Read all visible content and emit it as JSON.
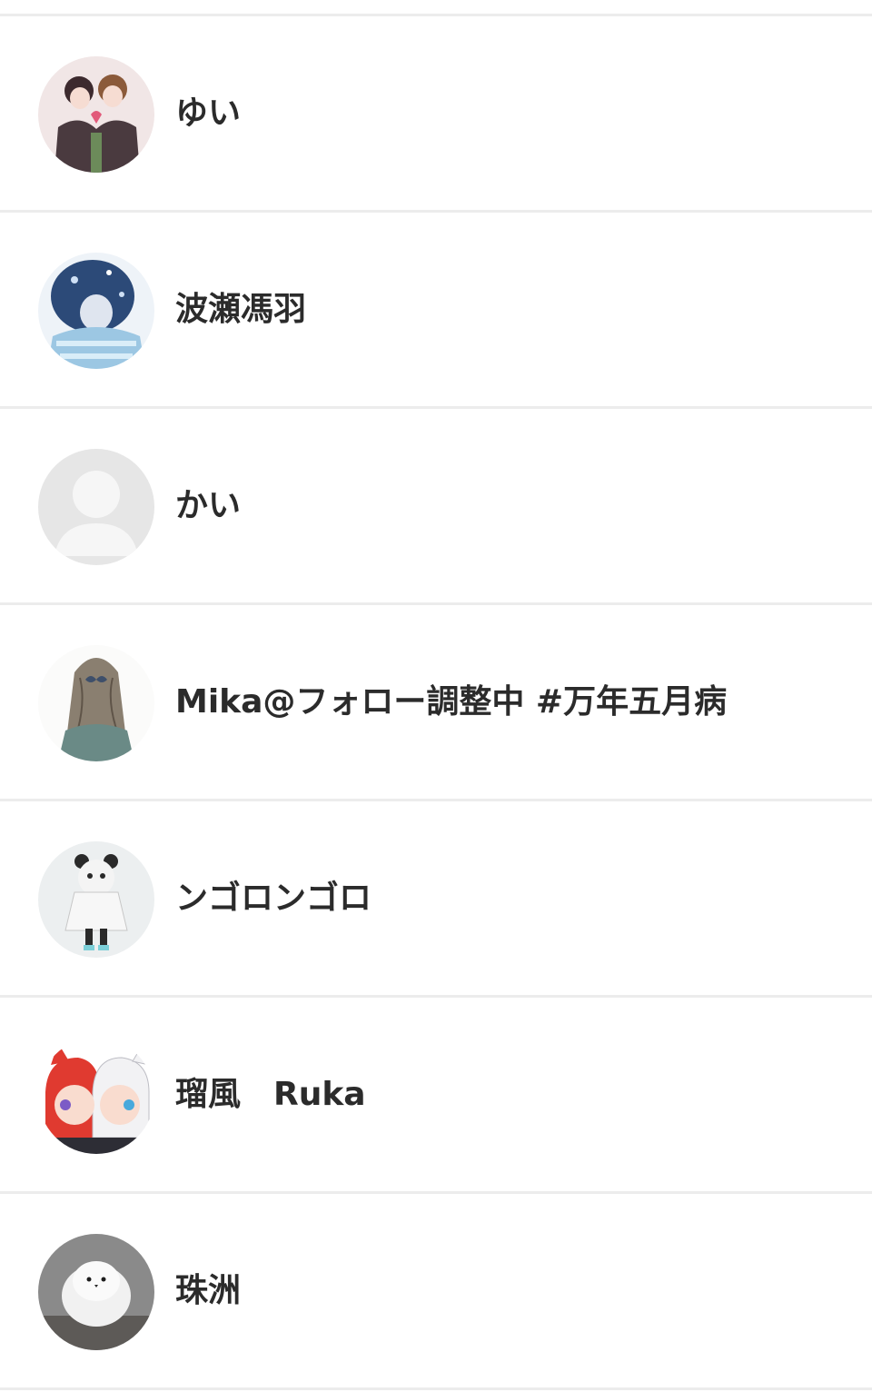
{
  "users": [
    {
      "name": "ゆい",
      "avatar": "illustrated-couple-avatar"
    },
    {
      "name": "波瀬馮羽",
      "avatar": "illustrated-blue-hair-avatar"
    },
    {
      "name": "かい",
      "avatar": "default-user-avatar"
    },
    {
      "name": "Mika@フォロー調整中 #万年五月病",
      "avatar": "illustrated-long-hair-girl-avatar"
    },
    {
      "name": "ンゴロンゴロ",
      "avatar": "illustrated-panda-hood-avatar"
    },
    {
      "name": "瑠風　Ruka",
      "avatar": "illustrated-two-characters-avatar"
    },
    {
      "name": "珠洲",
      "avatar": "white-bird-photo-avatar"
    }
  ],
  "colors": {
    "divider": "#ececec",
    "name_text": "#2b2b2b",
    "placeholder_bg": "#e6e6e6",
    "placeholder_fg": "#f6f6f6"
  }
}
